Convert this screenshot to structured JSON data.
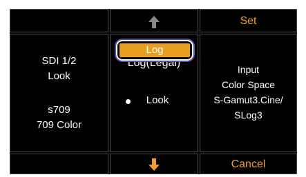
{
  "left_panel": {
    "signal_line1": "SDI 1/2",
    "signal_line2": "Look",
    "output_line1": "s709",
    "output_line2": "709 Color"
  },
  "middle_panel": {
    "options": [
      {
        "label": "Log",
        "state": "highlighted"
      },
      {
        "label": "Log(Legal)",
        "state": "partially-visible"
      },
      {
        "label": "Look",
        "state": "current"
      }
    ],
    "up_icon": "arrow-up-icon",
    "down_icon": "arrow-down-icon"
  },
  "right_panel": {
    "set_label": "Set",
    "cancel_label": "Cancel",
    "info_line1": "Input",
    "info_line2": "Color Space",
    "info_line3": "S-Gamut3.Cine/",
    "info_line4": "SLog3"
  },
  "colors": {
    "accent": "#f0a030",
    "highlight": "#e8a020",
    "focus_ring": "#5a50a0",
    "arrow": "#8a8a8a"
  }
}
